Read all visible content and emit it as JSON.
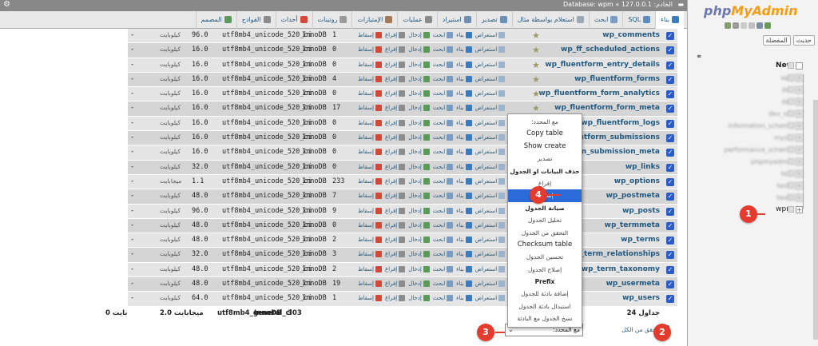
{
  "nav": {
    "logo_php": "php",
    "logo_myadmin": "MyAdmin",
    "btn_recent": "حديث",
    "btn_favorites": "المفضلة",
    "databases": [
      {
        "name": "New",
        "style": "new"
      },
      {
        "name": "wp_",
        "style": "blur"
      },
      {
        "name": "doc",
        "style": "blur"
      },
      {
        "name": "dev",
        "style": "blur"
      },
      {
        "name": "dev_old",
        "style": "blur"
      },
      {
        "name": "information_schema",
        "style": "blur"
      },
      {
        "name": "mysql",
        "style": "blur"
      },
      {
        "name": "performance_schema",
        "style": "blur"
      },
      {
        "name": "phpmyadmin",
        "style": "blur"
      },
      {
        "name": "test",
        "style": "blur"
      },
      {
        "name": "test2",
        "style": "blur"
      },
      {
        "name": "test3",
        "style": "blur"
      },
      {
        "name": "wpm",
        "style": "wpm"
      }
    ]
  },
  "topbar": {
    "breadcrumb": "الخادم: 127.0.0.1 » Database: wpm"
  },
  "tabs": [
    {
      "label": "بناء",
      "color": "#3b7bbf",
      "active": true
    },
    {
      "label": "SQL",
      "color": "#5a8cc0"
    },
    {
      "label": "ابحث",
      "color": "#7a9cc0"
    },
    {
      "label": "استعلام بواسطة مثال",
      "color": "#9aa8b8"
    },
    {
      "label": "تصدير",
      "color": "#6d8fb3"
    },
    {
      "label": "استيراد",
      "color": "#6d8fb3"
    },
    {
      "label": "عمليات",
      "color": "#8c8c8c"
    },
    {
      "label": "الإمتيازات",
      "color": "#a07a5a"
    },
    {
      "label": "روتينات",
      "color": "#9a9a9a"
    },
    {
      "label": "أحداث",
      "color": "#d04a3a"
    },
    {
      "label": "القوادح",
      "color": "#8a8a8a"
    },
    {
      "label": "المصمم",
      "color": "#5a9a5a"
    }
  ],
  "table": {
    "actions": [
      "استعراض",
      "بناء",
      "ابحث",
      "إدخال",
      "إفراغ",
      "إسقاط"
    ],
    "rows": [
      {
        "name": "wp_comments",
        "count": "1",
        "engine": "InnoDB",
        "collation": "utf8mb4_unicode_520_ci",
        "size": "96.0",
        "unit": "كيلوبايت",
        "overhead": "-"
      },
      {
        "name": "wp_ff_scheduled_actions",
        "count": "0",
        "engine": "InnoDB",
        "collation": "utf8mb4_unicode_520_ci",
        "size": "16.0",
        "unit": "كيلوبايت",
        "overhead": "-"
      },
      {
        "name": "wp_fluentform_entry_details",
        "count": "0",
        "engine": "InnoDB",
        "collation": "utf8mb4_unicode_520_ci",
        "size": "16.0",
        "unit": "كيلوبايت",
        "overhead": "-"
      },
      {
        "name": "wp_fluentform_forms",
        "count": "4",
        "engine": "InnoDB",
        "collation": "utf8mb4_unicode_520_ci",
        "size": "16.0",
        "unit": "كيلوبايت",
        "overhead": "-"
      },
      {
        "name": "wp_fluentform_form_analytics",
        "count": "0",
        "engine": "InnoDB",
        "collation": "utf8mb4_unicode_520_ci",
        "size": "16.0",
        "unit": "كيلوبايت",
        "overhead": "-"
      },
      {
        "name": "wp_fluentform_form_meta",
        "count": "17",
        "engine": "InnoDB",
        "collation": "utf8mb4_unicode_520_ci",
        "size": "16.0",
        "unit": "كيلوبايت",
        "overhead": "-"
      },
      {
        "name": "wp_fluentform_logs",
        "count": "0",
        "engine": "InnoDB",
        "collation": "utf8mb4_unicode_520_ci",
        "size": "16.0",
        "unit": "كيلوبايت",
        "overhead": "-"
      },
      {
        "name": "wp_fluentform_submissions",
        "count": "0",
        "engine": "InnoDB",
        "collation": "utf8mb4_unicode_520_ci",
        "size": "16.0",
        "unit": "كيلوبايت",
        "overhead": "-"
      },
      {
        "name": "wp_fluentform_submission_meta",
        "count": "0",
        "engine": "InnoDB",
        "collation": "utf8mb4_unicode_520_ci",
        "size": "16.0",
        "unit": "كيلوبايت",
        "overhead": "-"
      },
      {
        "name": "wp_links",
        "count": "0",
        "engine": "InnoDB",
        "collation": "utf8mb4_unicode_520_ci",
        "size": "32.0",
        "unit": "كيلوبايت",
        "overhead": "-"
      },
      {
        "name": "wp_options",
        "count": "233",
        "engine": "InnoDB",
        "collation": "utf8mb4_unicode_520_ci",
        "size": "1.1",
        "unit": "ميجابايت",
        "overhead": "-"
      },
      {
        "name": "wp_postmeta",
        "count": "7",
        "engine": "InnoDB",
        "collation": "utf8mb4_unicode_520_ci",
        "size": "48.0",
        "unit": "كيلوبايت",
        "overhead": "-"
      },
      {
        "name": "wp_posts",
        "count": "9",
        "engine": "InnoDB",
        "collation": "utf8mb4_unicode_520_ci",
        "size": "96.0",
        "unit": "كيلوبايت",
        "overhead": "-"
      },
      {
        "name": "wp_termmeta",
        "count": "0",
        "engine": "InnoDB",
        "collation": "utf8mb4_unicode_520_ci",
        "size": "48.0",
        "unit": "كيلوبايت",
        "overhead": "-"
      },
      {
        "name": "wp_terms",
        "count": "2",
        "engine": "InnoDB",
        "collation": "utf8mb4_unicode_520_ci",
        "size": "48.0",
        "unit": "كيلوبايت",
        "overhead": "-"
      },
      {
        "name": "wp_term_relationships",
        "count": "3",
        "engine": "InnoDB",
        "collation": "utf8mb4_unicode_520_ci",
        "size": "32.0",
        "unit": "كيلوبايت",
        "overhead": "-"
      },
      {
        "name": "wp_term_taxonomy",
        "count": "2",
        "engine": "InnoDB",
        "collation": "utf8mb4_unicode_520_ci",
        "size": "48.0",
        "unit": "كيلوبايت",
        "overhead": "-"
      },
      {
        "name": "wp_usermeta",
        "count": "19",
        "engine": "InnoDB",
        "collation": "utf8mb4_unicode_520_ci",
        "size": "48.0",
        "unit": "كيلوبايت",
        "overhead": "-"
      },
      {
        "name": "wp_users",
        "count": "1",
        "engine": "InnoDB",
        "collation": "utf8mb4_unicode_520_ci",
        "size": "64.0",
        "unit": "كيلوبايت",
        "overhead": "-"
      }
    ],
    "summary": {
      "tables": "24 جداول",
      "rows": "303",
      "engine": "InnoDB",
      "collation": "utf8mb4_general_ci",
      "size": "2.0 ميجابايت",
      "overhead": "0 بايت"
    }
  },
  "footer": {
    "check_all": "تحقق من الكل",
    "with_selected": "مع المحدد:"
  },
  "menu": {
    "items": [
      {
        "label": "مع المحدد:",
        "kind": "plain"
      },
      {
        "label": "Copy table",
        "kind": "big"
      },
      {
        "label": "Show create",
        "kind": "big"
      },
      {
        "label": "تصدير",
        "kind": "plain"
      },
      {
        "label": "حذف البيانات او الجدول",
        "kind": "head"
      },
      {
        "label": "إفراغ",
        "kind": "plain"
      },
      {
        "label": "إسقاط",
        "kind": "sel"
      },
      {
        "label": "صيانة الجدول",
        "kind": "head"
      },
      {
        "label": "تحليل الجدول",
        "kind": "plain"
      },
      {
        "label": "التحقق من الجدول",
        "kind": "plain"
      },
      {
        "label": "Checksum table",
        "kind": "big"
      },
      {
        "label": "تحسين الجدول",
        "kind": "plain"
      },
      {
        "label": "إصلاح الجدول",
        "kind": "plain"
      },
      {
        "label": "Prefix",
        "kind": "head"
      },
      {
        "label": "إضافة بادئة للجدول",
        "kind": "plain"
      },
      {
        "label": "استبدال بادئة الجدول",
        "kind": "plain"
      },
      {
        "label": "نسخ الجدول مع البادئة",
        "kind": "plain"
      }
    ]
  },
  "markers": [
    "1",
    "2",
    "3",
    "4"
  ],
  "colors": {
    "accent": "#2a6ad9",
    "marker": "#e33b2e",
    "link": "#235a81"
  }
}
